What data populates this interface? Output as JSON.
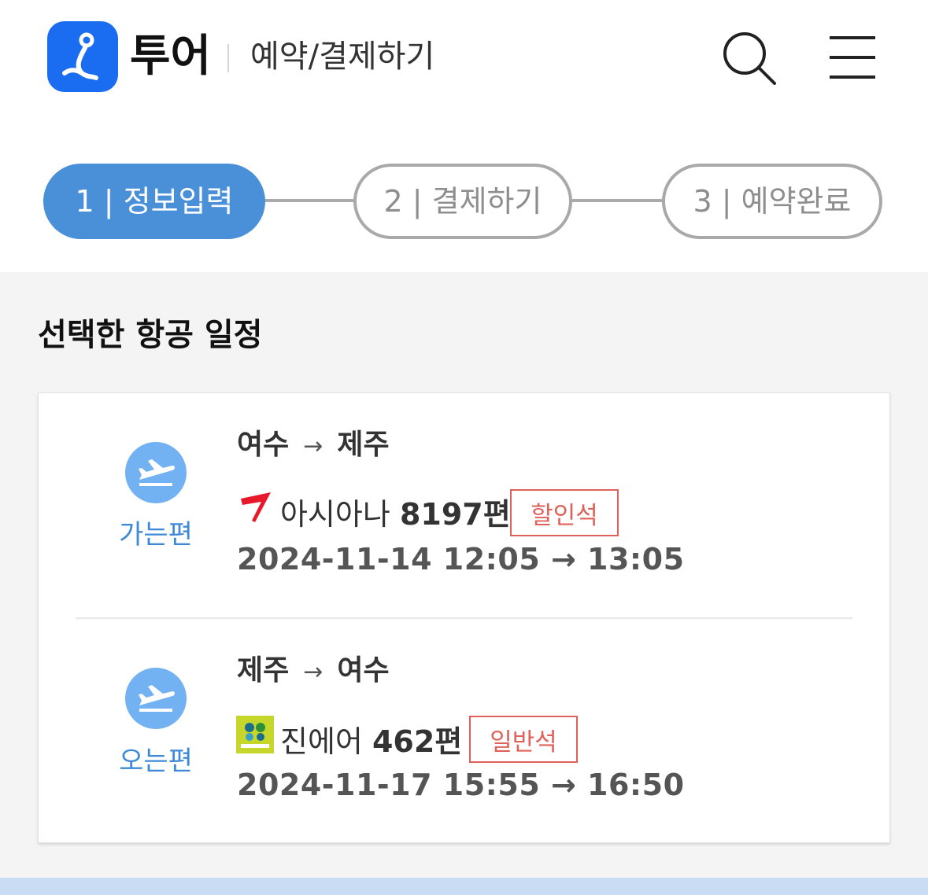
{
  "header": {
    "brand": "투어",
    "title": "예약/결제하기",
    "accent_color": "#1a6cf0",
    "icons": {
      "logo": "tour-logo-icon",
      "search": "search-icon",
      "menu": "hamburger-menu-icon"
    }
  },
  "steps": [
    {
      "label": "1 | 정보입력",
      "state": "active"
    },
    {
      "label": "2 | 결제하기",
      "state": "inactive"
    },
    {
      "label": "3 | 예약완료",
      "state": "inactive"
    }
  ],
  "section": {
    "title": "선택한 항공 일정"
  },
  "flights": [
    {
      "direction": "가는편",
      "from": "여수",
      "arrow": "→",
      "to": "제주",
      "airline": "아시아나",
      "flight_no": "8197편",
      "seat_class": "할인석",
      "schedule": "2024-11-14 12:05 → 13:05",
      "logo_icon": "asiana-logo-icon"
    },
    {
      "direction": "오는편",
      "from": "제주",
      "arrow": "→",
      "to": "여수",
      "airline": "진에어",
      "flight_no": "462편",
      "seat_class": "일반석",
      "schedule": "2024-11-17 15:55 → 16:50",
      "logo_icon": "jinair-logo-icon"
    }
  ],
  "colors": {
    "step_active": "#4a90d9",
    "direction_label": "#3e8ad6",
    "badge": "#e0605a",
    "plane_circle": "#72b1f2"
  }
}
